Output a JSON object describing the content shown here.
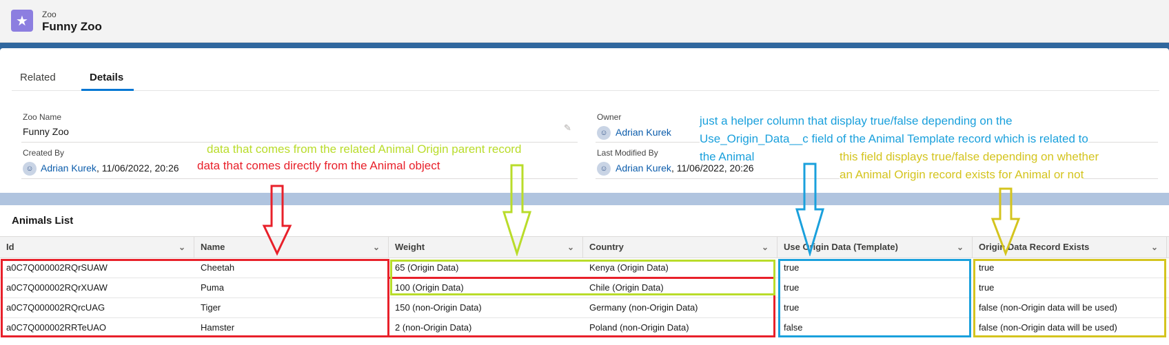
{
  "header": {
    "object_type": "Zoo",
    "record_name": "Funny Zoo",
    "icon": "star-icon"
  },
  "tabs": [
    {
      "label": "Related",
      "active": false
    },
    {
      "label": "Details",
      "active": true
    }
  ],
  "details": {
    "zoo_name_label": "Zoo Name",
    "zoo_name_value": "Funny Zoo",
    "created_by_label": "Created By",
    "created_by_user": "Adrian Kurek",
    "created_by_date": ", 11/06/2022, 20:26",
    "owner_label": "Owner",
    "owner_value": "Adrian Kurek",
    "last_modified_label": "Last Modified By",
    "last_modified_user": "Adrian Kurek",
    "last_modified_date": ", 11/06/2022, 20:26"
  },
  "animals_list": {
    "title": "Animals List",
    "columns": [
      "Id",
      "Name",
      "Weight",
      "Country",
      "Use Origin Data (Template)",
      "Origin Data Record Exists"
    ],
    "rows": [
      [
        "a0C7Q000002RQrSUAW",
        "Cheetah",
        "65 (Origin Data)",
        "Kenya (Origin Data)",
        "true",
        "true"
      ],
      [
        "a0C7Q000002RQrXUAW",
        "Puma",
        "100 (Origin Data)",
        "Chile (Origin Data)",
        "true",
        "true"
      ],
      [
        "a0C7Q000002RQrcUAG",
        "Tiger",
        "150 (non-Origin Data)",
        "Germany (non-Origin Data)",
        "true",
        "false (non-Origin data will be used)"
      ],
      [
        "a0C7Q000002RRTeUAO",
        "Hamster",
        "2 (non-Origin Data)",
        "Poland (non-Origin Data)",
        "false",
        "false (non-Origin data will be used)"
      ]
    ]
  },
  "annotations": {
    "origin_note": "data that comes from the related Animal Origin parent record",
    "animal_note": "data that comes directly from the Animal object",
    "helper_note_1": "just a helper column that display true/false depending on the",
    "helper_note_2": "Use_Origin_Data__c field of the Animal Template record which is related to",
    "helper_note_3": "the Animal",
    "exists_note_1": "this field displays true/false depending on whether",
    "exists_note_2": "an Animal Origin record exists for Animal or not"
  },
  "colors": {
    "brand_blue": "#0176d3",
    "link_blue": "#0b5cab",
    "object_icon_purple": "#8c7ee0",
    "annotation_red": "#e8202a",
    "annotation_lime": "#b9dc2a",
    "annotation_cyan": "#1aa0dc",
    "annotation_gold": "#d4c41e"
  }
}
